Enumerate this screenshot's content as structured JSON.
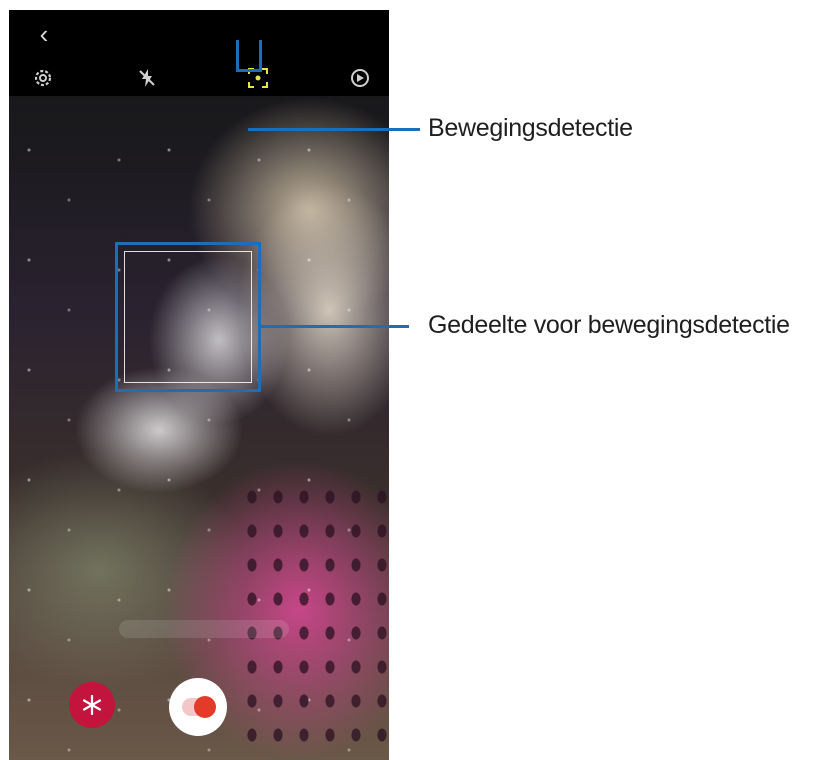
{
  "camera": {
    "back_glyph": "‹",
    "icons": {
      "settings": "gear-icon",
      "flash": "flash-off-icon",
      "motion_detection": "motion-detection-icon",
      "effects": "slow-motion-icon",
      "shutter": "record-button"
    },
    "colors": {
      "callout": "#1a6fb8",
      "effect_button": "#c2143c",
      "record_dot": "#e43a2a"
    }
  },
  "callouts": {
    "motion_detection_label": "Bewegingsdetectie",
    "detection_area_label": "Gedeelte voor bewegingsdetectie"
  }
}
